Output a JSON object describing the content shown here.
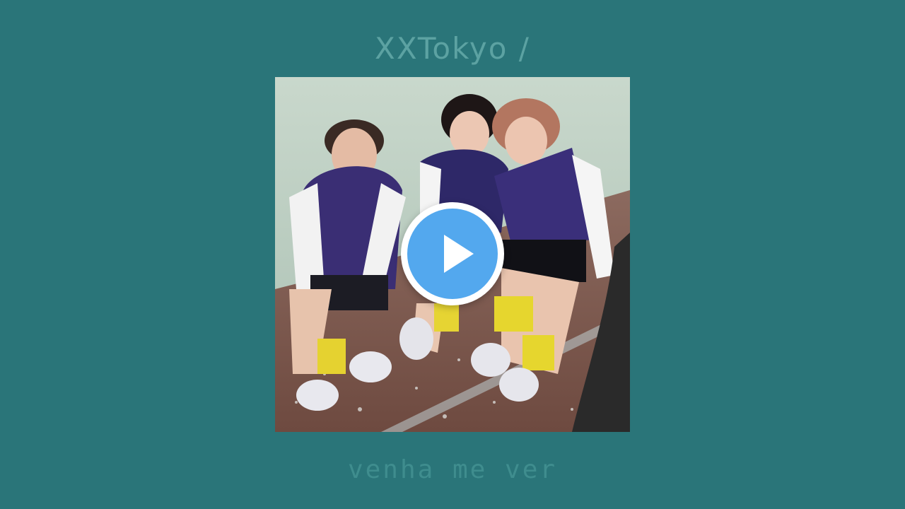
{
  "header": {
    "title": "XXTokyo /"
  },
  "cover": {
    "alt": "album cover art"
  },
  "player": {
    "play_icon": "play-icon"
  },
  "footer": {
    "subtitle": "venha me ver"
  },
  "colors": {
    "background": "#2a7579",
    "title": "#5fa5a5",
    "subtitle": "#3f8d8e",
    "play": "#53a8ee"
  }
}
